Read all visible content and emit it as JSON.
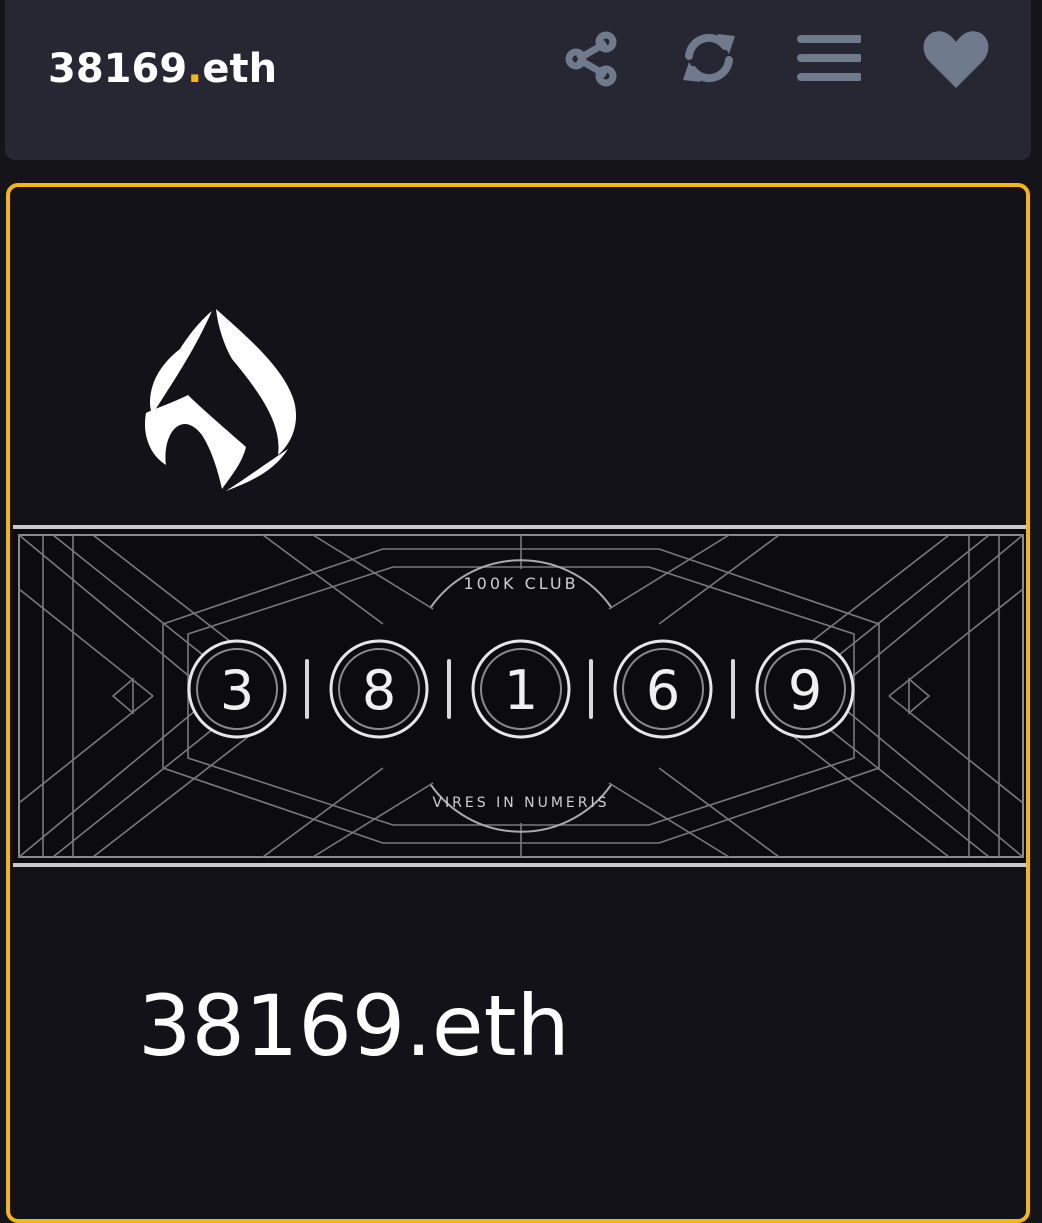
{
  "header": {
    "title_name": "38169",
    "title_dot": ".",
    "title_tld": "eth",
    "icons": [
      "share-icon",
      "refresh-icon",
      "menu-icon",
      "heart-icon"
    ]
  },
  "nft_card": {
    "banner_top_text": "100K CLUB",
    "digits": [
      "3",
      "8",
      "1",
      "6",
      "9"
    ],
    "banner_bottom_text": "VIRES IN NUMERIS",
    "name": "38169.eth"
  },
  "colors": {
    "accent": "#f5b70d",
    "header_bg": "#262733",
    "card_bg": "#131218",
    "icon_gray": "#6f7a8c"
  }
}
